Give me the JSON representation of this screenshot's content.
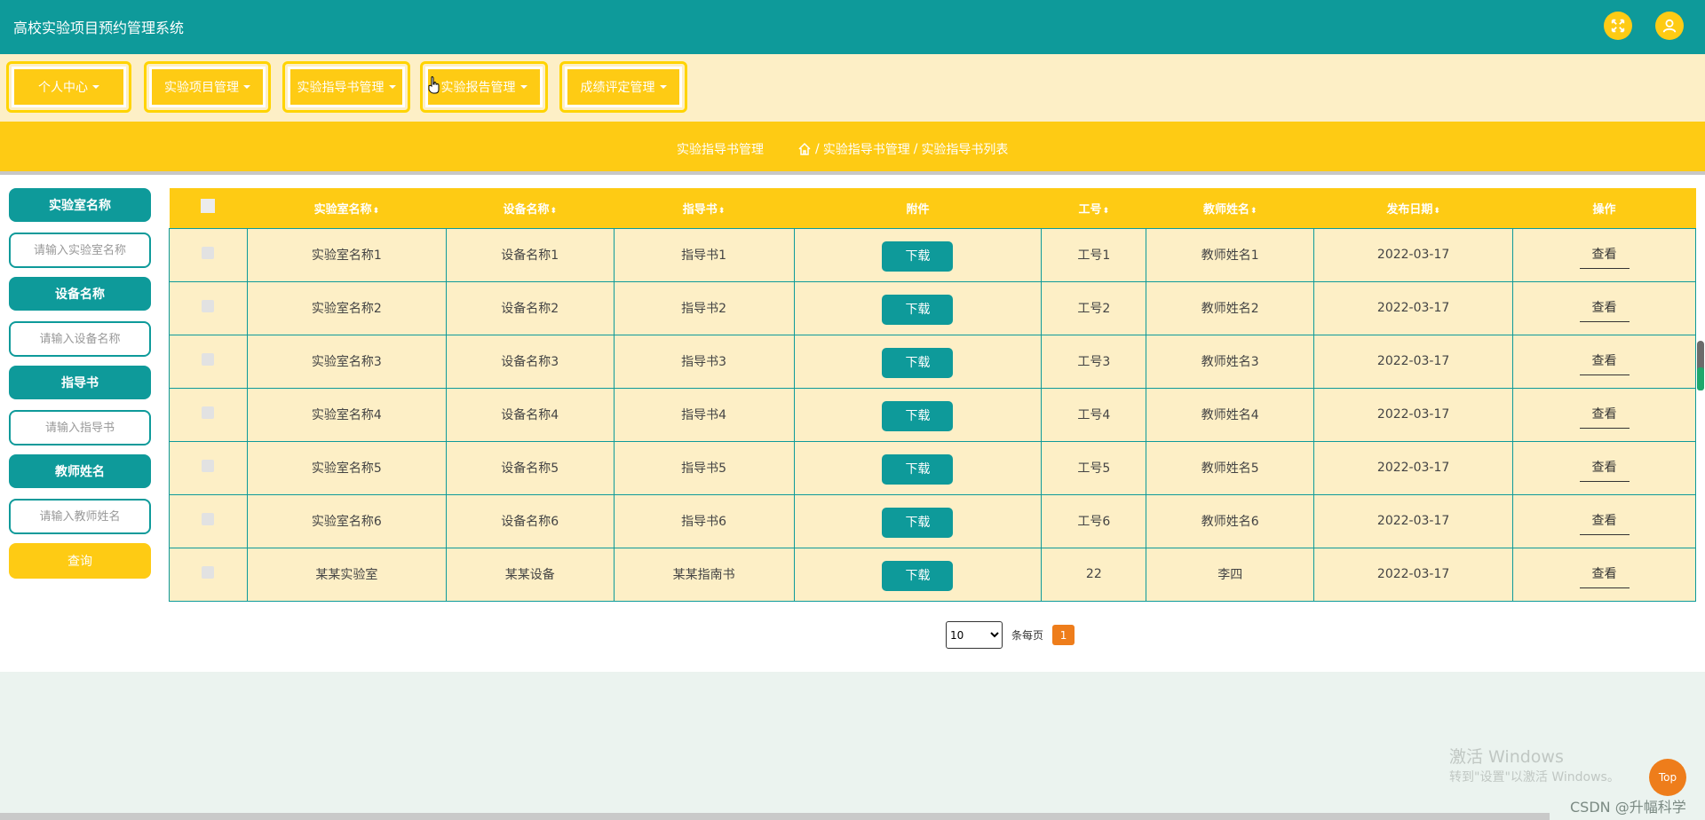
{
  "app": {
    "title": "高校实验项目预约管理系统"
  },
  "header": {
    "fullscreen_icon": "expand-arrows-icon",
    "user_icon": "user-icon"
  },
  "nav": {
    "items": [
      {
        "label": "个人中心"
      },
      {
        "label": "实验项目管理"
      },
      {
        "label": "实验指导书管理"
      },
      {
        "label": "实验报告管理"
      },
      {
        "label": "成绩评定管理"
      }
    ]
  },
  "band": {
    "title": "实验指导书管理",
    "breadcrumb": [
      "实验指导书管理",
      "实验指导书列表"
    ],
    "separator": "/"
  },
  "search": {
    "lab_label": "实验室名称",
    "lab_placeholder": "请输入实验室名称",
    "device_label": "设备名称",
    "device_placeholder": "请输入设备名称",
    "guide_label": "指导书",
    "guide_placeholder": "请输入指导书",
    "teacher_label": "教师姓名",
    "teacher_placeholder": "请输入教师姓名",
    "query_label": "查询"
  },
  "table": {
    "headers": {
      "lab": "实验室名称",
      "device": "设备名称",
      "guide": "指导书",
      "attachment": "附件",
      "job_no": "工号",
      "teacher": "教师姓名",
      "date": "发布日期",
      "action": "操作"
    },
    "sort_glyph": "⬍",
    "download_label": "下载",
    "view_label": "查看",
    "rows": [
      {
        "lab": "实验室名称1",
        "device": "设备名称1",
        "guide": "指导书1",
        "job_no": "工号1",
        "teacher": "教师姓名1",
        "date": "2022-03-17"
      },
      {
        "lab": "实验室名称2",
        "device": "设备名称2",
        "guide": "指导书2",
        "job_no": "工号2",
        "teacher": "教师姓名2",
        "date": "2022-03-17"
      },
      {
        "lab": "实验室名称3",
        "device": "设备名称3",
        "guide": "指导书3",
        "job_no": "工号3",
        "teacher": "教师姓名3",
        "date": "2022-03-17"
      },
      {
        "lab": "实验室名称4",
        "device": "设备名称4",
        "guide": "指导书4",
        "job_no": "工号4",
        "teacher": "教师姓名4",
        "date": "2022-03-17"
      },
      {
        "lab": "实验室名称5",
        "device": "设备名称5",
        "guide": "指导书5",
        "job_no": "工号5",
        "teacher": "教师姓名5",
        "date": "2022-03-17"
      },
      {
        "lab": "实验室名称6",
        "device": "设备名称6",
        "guide": "指导书6",
        "job_no": "工号6",
        "teacher": "教师姓名6",
        "date": "2022-03-17"
      },
      {
        "lab": "某某实验室",
        "device": "某某设备",
        "guide": "某某指南书",
        "job_no": "22",
        "teacher": "李四",
        "date": "2022-03-17"
      }
    ]
  },
  "pagination": {
    "page_size": "10",
    "page_size_options": [
      "10"
    ],
    "per_page_label": "条每页",
    "current_page": "1"
  },
  "overlay": {
    "watermark_line1": "激活 Windows",
    "watermark_line2": "转到\"设置\"以激活 Windows。",
    "top_label": "Top",
    "csdn_label": "CSDN @升幅科学"
  },
  "colors": {
    "teal": "#0e9a9a",
    "yellow": "#fecb14",
    "cream": "#fdefc6",
    "orange": "#ee7d1b"
  }
}
